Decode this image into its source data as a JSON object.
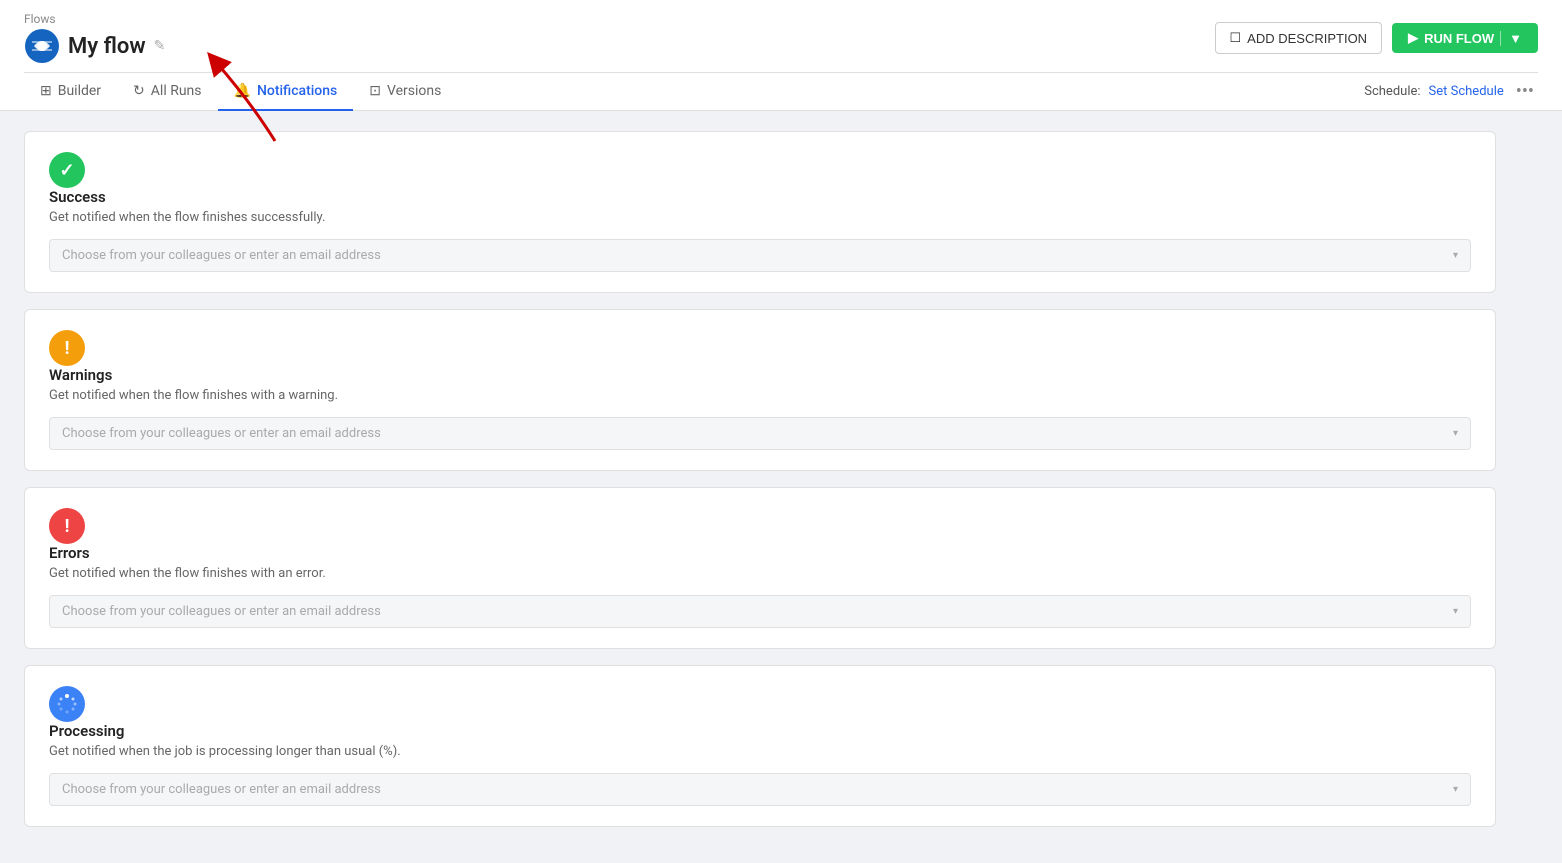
{
  "breadcrumb": {
    "label": "Flows",
    "link": "#"
  },
  "page": {
    "title": "My flow",
    "edit_icon": "✎"
  },
  "header_buttons": {
    "add_description": "ADD DESCRIPTION",
    "run_flow": "RUN FLOW"
  },
  "tabs": [
    {
      "id": "builder",
      "label": "Builder",
      "icon": "⊞",
      "active": false
    },
    {
      "id": "all-runs",
      "label": "All Runs",
      "icon": "↻",
      "active": false
    },
    {
      "id": "notifications",
      "label": "Notifications",
      "icon": "🔔",
      "active": true
    },
    {
      "id": "versions",
      "label": "Versions",
      "icon": "⊡",
      "active": false
    }
  ],
  "schedule": {
    "label": "Schedule:",
    "link_label": "Set Schedule"
  },
  "more_button": "•••",
  "notifications": [
    {
      "id": "success",
      "icon_type": "success",
      "icon_char": "✓",
      "title": "Success",
      "description": "Get notified when the flow finishes successfully.",
      "placeholder": "Choose from your colleagues or enter an email address"
    },
    {
      "id": "warnings",
      "icon_type": "warning",
      "icon_char": "!",
      "title": "Warnings",
      "description": "Get notified when the flow finishes with a warning.",
      "placeholder": "Choose from your colleagues or enter an email address"
    },
    {
      "id": "errors",
      "icon_type": "error",
      "icon_char": "!",
      "title": "Errors",
      "description": "Get notified when the flow finishes with an error.",
      "placeholder": "Choose from your colleagues or enter an email address"
    },
    {
      "id": "processing",
      "icon_type": "processing",
      "icon_char": "⊙",
      "title": "Processing",
      "description": "Get notified when the job is processing longer than usual (%).",
      "placeholder": "Choose from your colleagues or enter an email address"
    }
  ],
  "annotation": {
    "arrow_label": "Notifications tab arrow pointer"
  }
}
